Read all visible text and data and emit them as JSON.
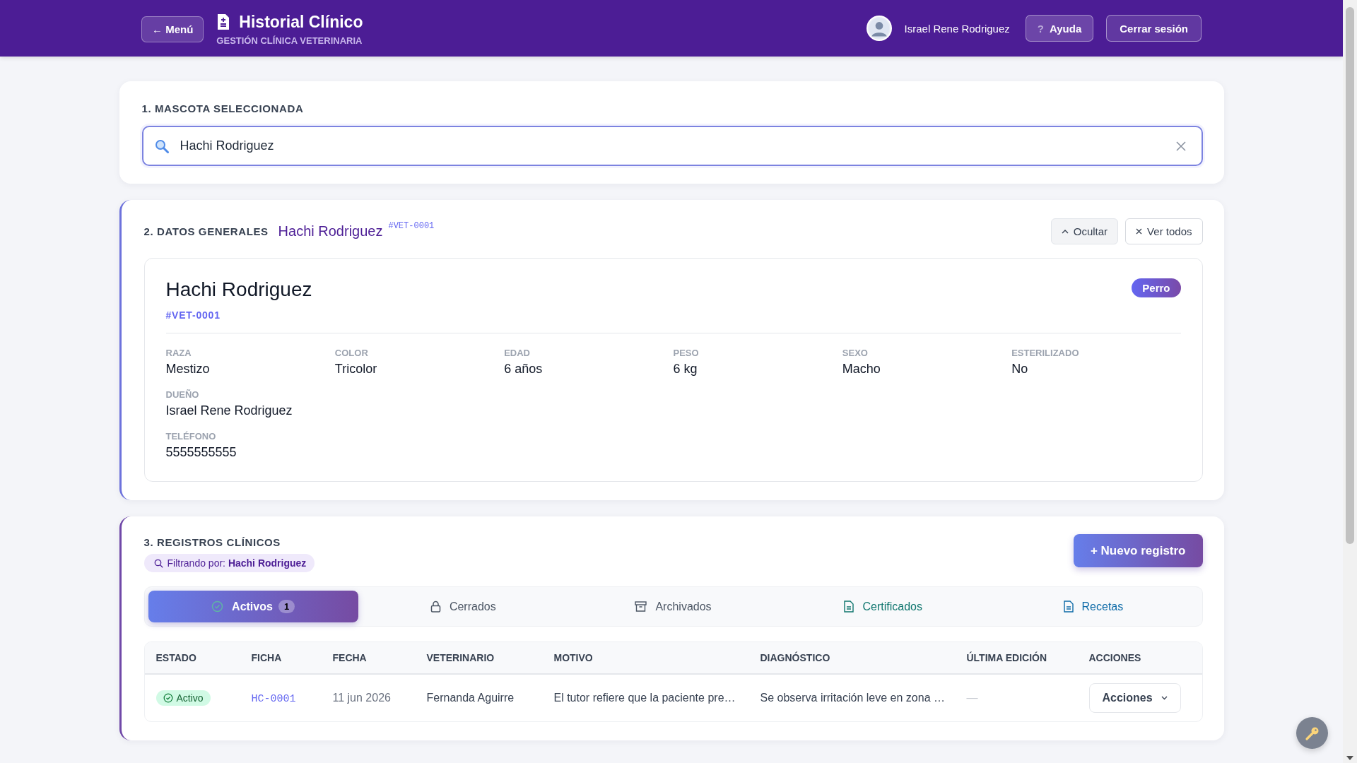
{
  "header": {
    "menu_button": "← Menú",
    "title": "Historial Clínico",
    "subtitle": "GESTIÓN CLÍNICA VETERINARIA",
    "user_name": "Israel Rene Rodriguez",
    "help_icon": "?",
    "help_button": "Ayuda",
    "logout_button": "Cerrar sesión"
  },
  "pet_selection": {
    "heading": "1. MASCOTA SELECCIONADA",
    "search_value": "Hachi Rodriguez"
  },
  "general_data": {
    "heading": "2. DATOS GENERALES",
    "pet_name": "Hachi Rodriguez",
    "pet_id": "#VET-0001",
    "hide_button": "Ocultar",
    "view_all_button": "Ver todos",
    "card": {
      "name": "Hachi Rodriguez",
      "id": "#VET-0001",
      "species": "Perro",
      "fields": [
        {
          "label": "RAZA",
          "value": "Mestizo",
          "kind": "cell"
        },
        {
          "label": "COLOR",
          "value": "Tricolor",
          "kind": "cell"
        },
        {
          "label": "EDAD",
          "value": "6 años",
          "kind": "cell"
        },
        {
          "label": "PESO",
          "value": "6 kg",
          "kind": "cell"
        },
        {
          "label": "SEXO",
          "value": "Macho",
          "kind": "cell"
        },
        {
          "label": "ESTERILIZADO",
          "value": "No",
          "kind": "cell"
        },
        {
          "label": "DUEÑO",
          "value": "Israel Rene Rodriguez",
          "kind": "row"
        },
        {
          "label": "TELÉFONO",
          "value": "5555555555",
          "kind": "row"
        }
      ]
    }
  },
  "clinical_records": {
    "heading": "3. REGISTROS CLÍNICOS",
    "filter": "Filtrando por: **Hachi Rodriguez**",
    "new_button": "+ Nuevo registro",
    "tabs": [
      {
        "label": "Activos",
        "count": "1",
        "selected": true
      },
      {
        "label": "Cerrados",
        "selected": false,
        "color": "#4b5563"
      },
      {
        "label": "Archivados",
        "selected": false,
        "color": "#4b5563"
      },
      {
        "label": "Certificados",
        "selected": false,
        "color": "#0f766e"
      },
      {
        "label": "Recetas",
        "selected": false,
        "color": "#0e6ba8"
      }
    ],
    "table": {
      "columns": [
        "ESTADO",
        "FICHA",
        "FECHA",
        "VETERINARIO",
        "MOTIVO",
        "DIAGNÓSTICO",
        "ÚLTIMA EDICIÓN",
        "ACCIONES"
      ],
      "rows": [
        {
          "status": "Activo",
          "record": "HC-0001",
          "date": "11 jun 2026",
          "vet": "Fernanda Aguirre",
          "reason": "El tutor refiere que la paciente pre…",
          "diagnosis": "Se observa irritación leve en zona …",
          "last_edit": "—",
          "actions": "Acciones"
        }
      ]
    }
  }
}
